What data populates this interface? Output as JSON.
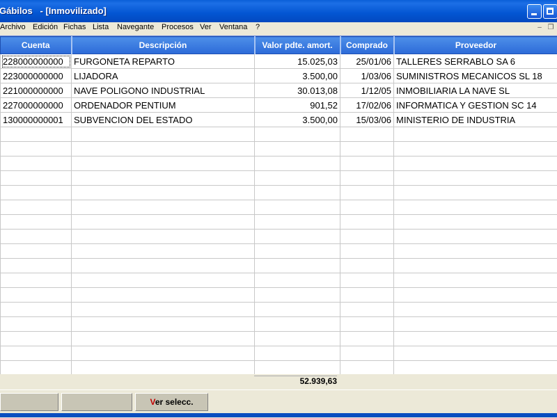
{
  "window": {
    "title": "Gábilos   - [Inmovilizado]"
  },
  "menu": [
    "Archivo",
    "Edición",
    "Fichas",
    "Lista",
    "Navegante",
    "Procesos",
    "Ver",
    "Ventana",
    "?"
  ],
  "table": {
    "headers": [
      "Cuenta",
      "Descripción",
      "Valor pdte. amort.",
      "Comprado",
      "Proveedor"
    ],
    "rows": [
      [
        "228000000000",
        "FURGONETA REPARTO",
        "15.025,03",
        "25/01/06",
        "TALLERES SERRABLO SA 6"
      ],
      [
        "223000000000",
        "LIJADORA",
        "3.500,00",
        "1/03/06",
        "SUMINISTROS MECANICOS SL 18"
      ],
      [
        "221000000000",
        "NAVE POLIGONO INDUSTRIAL",
        "30.013,08",
        "1/12/05",
        "INMOBILIARIA LA NAVE SL"
      ],
      [
        "227000000000",
        "ORDENADOR PENTIUM",
        "901,52",
        "17/02/06",
        "INFORMATICA Y GESTION SC  14"
      ],
      [
        "130000000001",
        "SUBVENCION DEL ESTADO",
        "3.500,00",
        "15/03/06",
        "MINISTERIO DE INDUSTRIA"
      ]
    ],
    "empty_rows": 17
  },
  "footer": {
    "total": "52.939,63",
    "button_hotkey": "V",
    "button_rest": "er selecc."
  },
  "colors": {
    "title_bar": "#0355d2",
    "header_bg": "#2c6ad8",
    "hotkey": "#c00000"
  }
}
